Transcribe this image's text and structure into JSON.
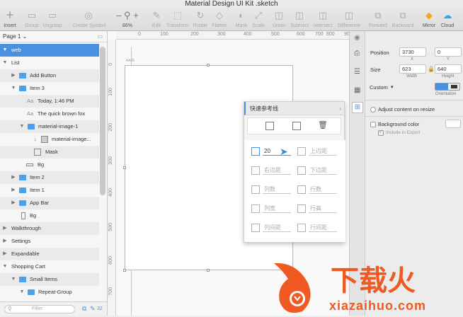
{
  "window": {
    "title": "Material Design UI Kit .sketch"
  },
  "toolbar": {
    "insert": "Insert",
    "group": "Group",
    "ungroup": "Ungroup",
    "create_symbol": "Create Symbol",
    "zoom": "86%",
    "edit": "Edit",
    "transform": "Transform",
    "rotate": "Rotate",
    "flatten": "Flatten",
    "mask": "Mask",
    "scale": "Scale",
    "union": "Union",
    "subtract": "Subtract",
    "intersect": "Intersect",
    "difference": "Difference",
    "forward": "Forward",
    "backward": "Backward",
    "mirror": "Mirror",
    "cloud": "Cloud"
  },
  "sidebar": {
    "page": "Page 1",
    "layers": [
      {
        "label": "web"
      },
      {
        "label": "List"
      },
      {
        "label": "Add Button"
      },
      {
        "label": "Item 3"
      },
      {
        "label": "Today, 1:46 PM"
      },
      {
        "label": "The quick brown fox"
      },
      {
        "label": "material-image-1"
      },
      {
        "label": "material-image..."
      },
      {
        "label": "Mask"
      },
      {
        "label": "Bg"
      },
      {
        "label": "Item 2"
      },
      {
        "label": "Item 1"
      },
      {
        "label": "App Bar"
      },
      {
        "label": "Bg"
      },
      {
        "label": "Walkthrough"
      },
      {
        "label": "Settings"
      },
      {
        "label": "Expandable"
      },
      {
        "label": "Shopping Cart"
      },
      {
        "label": "Small Items"
      },
      {
        "label": "Repeat-Group"
      }
    ],
    "filter_placeholder": "Filter",
    "count": "32"
  },
  "canvas": {
    "artboard_label": "web",
    "ruler_h": [
      "0",
      "100",
      "200",
      "300",
      "400",
      "500",
      "600",
      "700",
      "800",
      "900"
    ],
    "ruler_v": [
      "0",
      "100",
      "200",
      "300",
      "400",
      "500",
      "600",
      "700"
    ]
  },
  "popup": {
    "title": "快速参考线",
    "grid_value": "20",
    "top_margin": "上边距",
    "right_margin": "右边距",
    "bottom_margin": "下边距",
    "columns": "列数",
    "rows": "行数",
    "col_width": "列宽",
    "row_height": "行高",
    "col_gutter": "列间距",
    "row_gutter": "行间距"
  },
  "inspector": {
    "position_label": "Position",
    "x_value": "3730",
    "y_value": "0",
    "x_sub": "X",
    "y_sub": "Y",
    "size_label": "Size",
    "width_value": "623",
    "height_value": "640",
    "width_sub": "Width",
    "height_sub": "Height",
    "preset": "Custom",
    "orientation": "Orientation",
    "adjust_resize": "Adjust content on resize",
    "background_color": "Background color",
    "include_export": "Include in Export"
  },
  "watermark": {
    "brand": "下载火",
    "url": "xiazaihuo.com"
  },
  "colors": {
    "accent": "#4a90e2",
    "folder": "#4d9ff0",
    "watermark": "#f05a22"
  }
}
